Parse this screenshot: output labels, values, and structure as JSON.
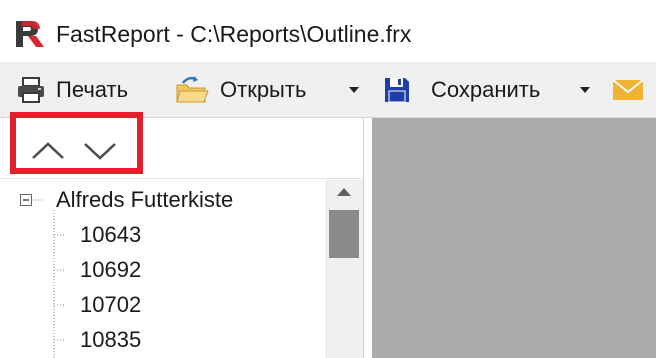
{
  "window": {
    "app_name": "FastReport",
    "title": "FastReport - C:\\Reports\\Outline.frx"
  },
  "toolbar": {
    "print_label": "Печать",
    "open_label": "Открыть",
    "save_label": "Сохранить"
  },
  "outline": {
    "root": "Alfreds Futterkiste",
    "children": [
      "10643",
      "10692",
      "10702",
      "10835"
    ]
  },
  "colors": {
    "highlight_box": "#e0202a",
    "preview_area": "#ababab",
    "toolbar_bg": "#f0f0f0",
    "save_icon": "#1f3fa8",
    "mail_icon": "#f2b233"
  },
  "icons": {
    "app": "fastreport-logo",
    "print": "printer-icon",
    "open": "open-folder-icon",
    "save": "floppy-disk-icon",
    "mail": "envelope-icon",
    "prev": "chevron-up-icon",
    "next": "chevron-down-icon",
    "collapse": "tree-minus-icon"
  }
}
